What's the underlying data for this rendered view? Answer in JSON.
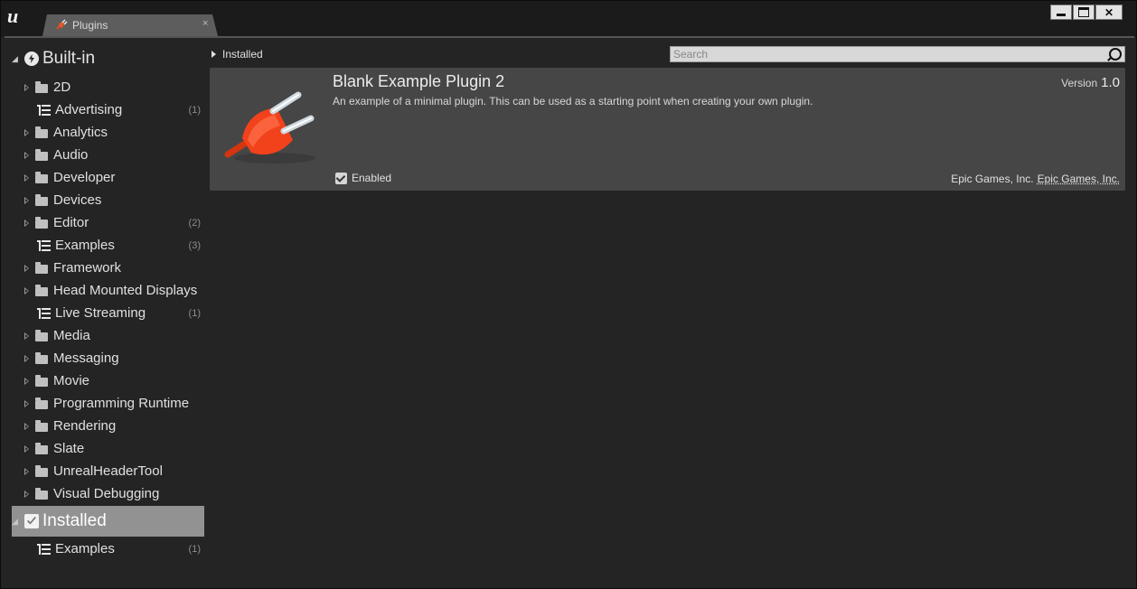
{
  "window": {
    "tab_title": "Plugins",
    "tab_close": "×",
    "controls": {
      "close": "✕"
    }
  },
  "sidebar": {
    "builtin": {
      "label": "Built-in",
      "items": [
        {
          "label": "2D",
          "count": "",
          "icon": "folder-icon",
          "expandable": true
        },
        {
          "label": "Advertising",
          "count": "(1)",
          "icon": "list-icon",
          "expandable": false
        },
        {
          "label": "Analytics",
          "count": "",
          "icon": "folder-icon",
          "expandable": true
        },
        {
          "label": "Audio",
          "count": "",
          "icon": "folder-icon",
          "expandable": true
        },
        {
          "label": "Developer",
          "count": "",
          "icon": "folder-icon",
          "expandable": true
        },
        {
          "label": "Devices",
          "count": "",
          "icon": "folder-icon",
          "expandable": true
        },
        {
          "label": "Editor",
          "count": "(2)",
          "icon": "folder-icon",
          "expandable": true
        },
        {
          "label": "Examples",
          "count": "(3)",
          "icon": "list-icon",
          "expandable": false
        },
        {
          "label": "Framework",
          "count": "",
          "icon": "folder-icon",
          "expandable": true
        },
        {
          "label": "Head Mounted Displays",
          "count": "",
          "icon": "folder-icon",
          "expandable": true
        },
        {
          "label": "Live Streaming",
          "count": "(1)",
          "icon": "list-icon",
          "expandable": false
        },
        {
          "label": "Media",
          "count": "",
          "icon": "folder-icon",
          "expandable": true
        },
        {
          "label": "Messaging",
          "count": "",
          "icon": "folder-icon",
          "expandable": true
        },
        {
          "label": "Movie",
          "count": "",
          "icon": "folder-icon",
          "expandable": true
        },
        {
          "label": "Programming Runtime",
          "count": "",
          "icon": "folder-icon",
          "expandable": true
        },
        {
          "label": "Rendering",
          "count": "",
          "icon": "folder-icon",
          "expandable": true
        },
        {
          "label": "Slate",
          "count": "",
          "icon": "folder-icon",
          "expandable": true
        },
        {
          "label": "UnrealHeaderTool",
          "count": "",
          "icon": "folder-icon",
          "expandable": true
        },
        {
          "label": "Visual Debugging",
          "count": "",
          "icon": "folder-icon",
          "expandable": true
        }
      ]
    },
    "installed": {
      "label": "Installed",
      "items": [
        {
          "label": "Examples",
          "count": "(1)",
          "icon": "list-icon",
          "expandable": false
        }
      ]
    }
  },
  "main": {
    "breadcrumb": "Installed",
    "search_placeholder": "Search",
    "plugin": {
      "name": "Blank Example Plugin 2",
      "description": "An example of a minimal plugin.  This can be used as a starting point when creating your own plugin.",
      "version_label": "Version",
      "version": "1.0",
      "enabled_label": "Enabled",
      "enabled": true,
      "author": "Epic Games, Inc.",
      "author_link": "Epic Games, Inc."
    }
  },
  "colors": {
    "window_bg": "#242424",
    "card_bg": "#464646",
    "selected_bg": "#929292",
    "plugin_icon": "#f2421b"
  }
}
